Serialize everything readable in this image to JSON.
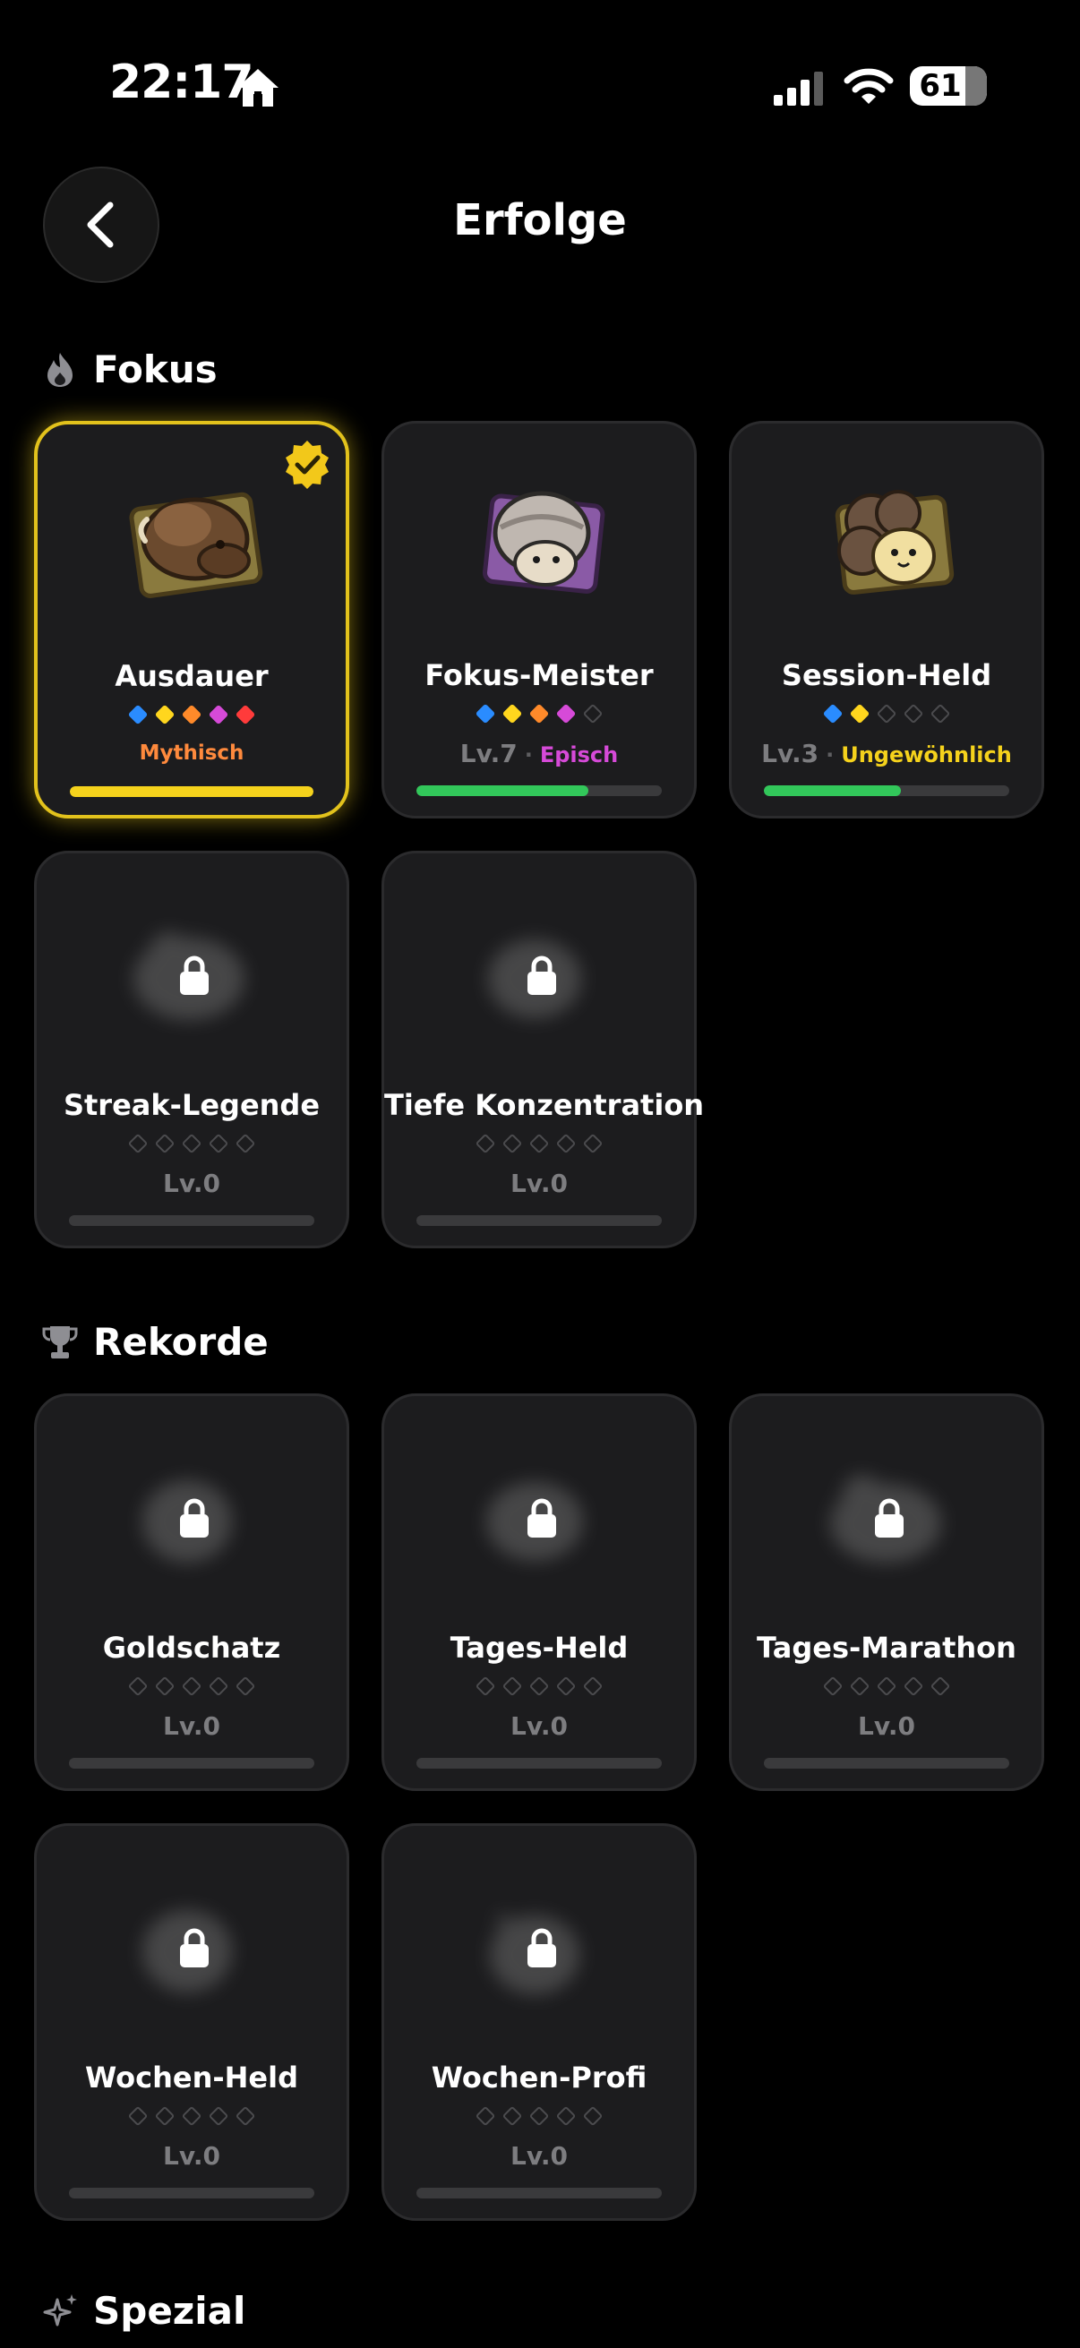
{
  "status_bar": {
    "time": "22:17",
    "battery": "61"
  },
  "header": {
    "title": "Erfolge"
  },
  "colors": {
    "blue": "#2a8cff",
    "yellow": "#ffd61e",
    "orange": "#ff8a2a",
    "magenta": "#d64ad8",
    "red": "#ff3b3b",
    "mythic": "#ff8a3d",
    "epic": "#d64ad8",
    "uncommon": "#f5d21c",
    "green": "#32c75a"
  },
  "sections": {
    "fokus": {
      "title": "Fokus",
      "cards": [
        {
          "name": "Ausdauer",
          "level": "",
          "rarity": "Mythisch",
          "progress": 1.0,
          "gems_filled": 5
        },
        {
          "name": "Fokus-Meister",
          "level": "Lv.7",
          "rarity": "Episch",
          "progress": 0.7,
          "gems_filled": 4
        },
        {
          "name": "Session-Held",
          "level": "Lv.3",
          "rarity": "Ungewöhnlich",
          "progress": 0.56,
          "gems_filled": 2
        },
        {
          "name": "Streak-Legende",
          "level": "Lv.0",
          "progress": 0
        },
        {
          "name": "Tiefe Konzentration",
          "level": "Lv.0",
          "progress": 0
        }
      ]
    },
    "rekorde": {
      "title": "Rekorde",
      "cards": [
        {
          "name": "Goldschatz",
          "level": "Lv.0"
        },
        {
          "name": "Tages-Held",
          "level": "Lv.0"
        },
        {
          "name": "Tages-Marathon",
          "level": "Lv.0"
        },
        {
          "name": "Wochen-Held",
          "level": "Lv.0"
        },
        {
          "name": "Wochen-Profi",
          "level": "Lv.0"
        }
      ]
    },
    "spezial": {
      "title": "Spezial"
    }
  },
  "icons": [
    "home-icon",
    "signal-icon",
    "wifi-icon",
    "back-chevron-icon",
    "flame-icon",
    "trophy-icon",
    "sparkles-icon",
    "verified-check-icon",
    "lock-icon"
  ]
}
